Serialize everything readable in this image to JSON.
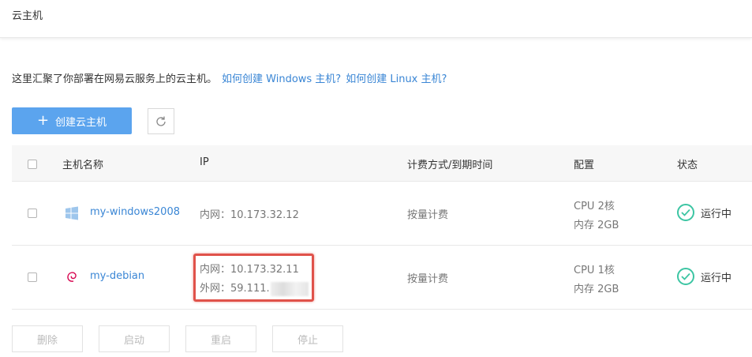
{
  "header": {
    "title": "云主机"
  },
  "intro": {
    "text": "这里汇聚了你部署在网易云服务上的云主机。",
    "link_windows": "如何创建 Windows 主机?",
    "link_linux": "如何创建 Linux 主机?"
  },
  "toolbar": {
    "create_label": "创建云主机",
    "create_icon": "plus-icon",
    "refresh_icon": "refresh-icon"
  },
  "table": {
    "columns": [
      "主机名称",
      "IP",
      "计费方式/到期时间",
      "配置",
      "状态"
    ],
    "rows": [
      {
        "name": "my-windows2008",
        "os_icon": "windows-icon",
        "ip_internal": "内网：10.173.32.12",
        "billing": "按量计费",
        "cpu": "CPU 2核",
        "mem": "内存 2GB",
        "status": "运行中"
      },
      {
        "name": "my-debian",
        "os_icon": "debian-icon",
        "ip_internal": "内网：10.173.32.11",
        "ip_external": "外网：59.111.",
        "billing": "按量计费",
        "cpu": "CPU 1核",
        "mem": "内存 2GB",
        "status": "运行中"
      }
    ]
  },
  "actions": {
    "delete": "删除",
    "start": "启动",
    "restart": "重启",
    "stop": "停止"
  },
  "colors": {
    "primary": "#5ba4ee",
    "link": "#3a86d5",
    "success": "#3cc5a3",
    "highlight": "#e0524a"
  }
}
